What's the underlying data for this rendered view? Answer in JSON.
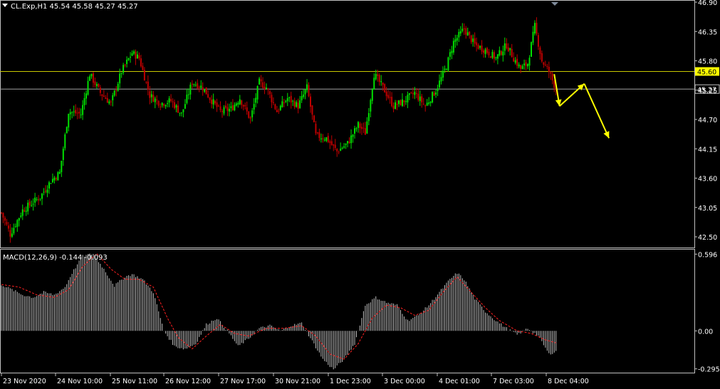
{
  "header": {
    "symbol_info": "CL.Exp,H1  45.54 45.58 45.27 45.27"
  },
  "indicator": {
    "label": "MACD(12,26,9) -0.144 -0.093"
  },
  "colors": {
    "background": "#000000",
    "frame": "#c0c0c0",
    "bull_candle": "#00e000",
    "bear_candle": "#c00000",
    "price_line": "#c8c800",
    "price_tag_bg": "#ffff00",
    "bid_line": "#a0a0a0",
    "arrow": "#ffff00",
    "histogram": "#c0c0c0",
    "signal": "#ff2020",
    "text": "#ffffff"
  },
  "chart_data": [
    {
      "type": "candlestick",
      "symbol": "CL.Exp",
      "timeframe": "H1",
      "ohlc_last": {
        "open": 45.54,
        "high": 45.58,
        "low": 45.27,
        "close": 45.27
      },
      "ylim": [
        42.3,
        46.9
      ],
      "y_ticks": [
        "46.90",
        "46.35",
        "45.80",
        "45.25",
        "44.70",
        "44.15",
        "43.60",
        "43.05",
        "42.50"
      ],
      "x_ticks": [
        "23 Nov 2020",
        "24 Nov 10:00",
        "25 Nov 11:00",
        "26 Nov 12:00",
        "27 Nov 17:00",
        "30 Nov 21:00",
        "1 Dec 23:00",
        "3 Dec 00:00",
        "4 Dec 01:00",
        "7 Dec 03:00",
        "8 Dec 04:00"
      ],
      "horizontal_lines": [
        {
          "value": 45.6,
          "label": "45.60",
          "kind": "level"
        },
        {
          "value": 45.27,
          "label": "45.27",
          "kind": "bid"
        }
      ],
      "anchors": [
        [
          0,
          42.95
        ],
        [
          5,
          42.55
        ],
        [
          12,
          43.0
        ],
        [
          22,
          43.25
        ],
        [
          28,
          43.55
        ],
        [
          33,
          43.7
        ],
        [
          38,
          44.85
        ],
        [
          45,
          44.8
        ],
        [
          50,
          45.55
        ],
        [
          56,
          45.2
        ],
        [
          62,
          45.0
        ],
        [
          68,
          45.6
        ],
        [
          74,
          45.95
        ],
        [
          78,
          45.85
        ],
        [
          84,
          45.15
        ],
        [
          90,
          45.0
        ],
        [
          96,
          45.05
        ],
        [
          102,
          44.8
        ],
        [
          108,
          45.4
        ],
        [
          114,
          45.3
        ],
        [
          118,
          45.1
        ],
        [
          124,
          44.85
        ],
        [
          130,
          44.9
        ],
        [
          135,
          45.1
        ],
        [
          141,
          44.7
        ],
        [
          146,
          45.4
        ],
        [
          150,
          45.3
        ],
        [
          156,
          44.85
        ],
        [
          162,
          45.1
        ],
        [
          168,
          44.95
        ],
        [
          173,
          45.3
        ],
        [
          178,
          44.4
        ],
        [
          184,
          44.35
        ],
        [
          190,
          44.1
        ],
        [
          196,
          44.25
        ],
        [
          202,
          44.6
        ],
        [
          206,
          44.45
        ],
        [
          211,
          45.55
        ],
        [
          216,
          45.3
        ],
        [
          222,
          44.95
        ],
        [
          228,
          45.05
        ],
        [
          234,
          45.2
        ],
        [
          240,
          44.95
        ],
        [
          246,
          45.25
        ],
        [
          252,
          45.7
        ],
        [
          256,
          46.15
        ],
        [
          262,
          46.4
        ],
        [
          268,
          46.1
        ],
        [
          274,
          46.0
        ],
        [
          280,
          45.85
        ],
        [
          286,
          46.1
        ],
        [
          290,
          45.85
        ],
        [
          294,
          45.65
        ],
        [
          298,
          45.75
        ],
        [
          302,
          46.45
        ],
        [
          306,
          45.8
        ],
        [
          310,
          45.6
        ],
        [
          314,
          45.27
        ]
      ],
      "anchors_note": "close price at hourly bar index",
      "bar_count": 315,
      "annotations": [
        {
          "type": "arrow",
          "from": [
            313,
            45.55
          ],
          "to": [
            316,
            44.95
          ]
        },
        {
          "type": "arrow",
          "from": [
            316,
            44.95
          ],
          "to": [
            330,
            45.37
          ]
        },
        {
          "type": "arrow",
          "from": [
            330,
            45.37
          ],
          "to": [
            344,
            44.35
          ]
        }
      ]
    },
    {
      "type": "macd",
      "params": "MACD(12,26,9)",
      "macd_last": -0.144,
      "signal_last": -0.093,
      "ylim": [
        -0.33,
        0.62
      ],
      "y_ticks": [
        "0.596",
        "0.00",
        "-0.295"
      ],
      "histogram_anchors": [
        [
          0,
          0.36
        ],
        [
          6,
          0.32
        ],
        [
          12,
          0.28
        ],
        [
          18,
          0.26
        ],
        [
          24,
          0.3
        ],
        [
          30,
          0.28
        ],
        [
          36,
          0.34
        ],
        [
          40,
          0.45
        ],
        [
          46,
          0.58
        ],
        [
          52,
          0.6
        ],
        [
          58,
          0.48
        ],
        [
          64,
          0.35
        ],
        [
          70,
          0.42
        ],
        [
          74,
          0.44
        ],
        [
          80,
          0.4
        ],
        [
          86,
          0.3
        ],
        [
          92,
          0.0
        ],
        [
          98,
          -0.12
        ],
        [
          104,
          -0.14
        ],
        [
          110,
          -0.1
        ],
        [
          116,
          0.05
        ],
        [
          122,
          0.1
        ],
        [
          128,
          0.0
        ],
        [
          134,
          -0.12
        ],
        [
          140,
          -0.06
        ],
        [
          146,
          0.02
        ],
        [
          152,
          0.04
        ],
        [
          158,
          0.0
        ],
        [
          164,
          0.04
        ],
        [
          170,
          0.06
        ],
        [
          176,
          -0.08
        ],
        [
          182,
          -0.22
        ],
        [
          188,
          -0.3
        ],
        [
          194,
          -0.22
        ],
        [
          200,
          -0.1
        ],
        [
          206,
          0.2
        ],
        [
          212,
          0.26
        ],
        [
          218,
          0.22
        ],
        [
          224,
          0.2
        ],
        [
          230,
          0.08
        ],
        [
          236,
          0.12
        ],
        [
          242,
          0.2
        ],
        [
          248,
          0.3
        ],
        [
          254,
          0.4
        ],
        [
          258,
          0.45
        ],
        [
          262,
          0.4
        ],
        [
          268,
          0.25
        ],
        [
          274,
          0.15
        ],
        [
          280,
          0.08
        ],
        [
          286,
          0.02
        ],
        [
          292,
          -0.03
        ],
        [
          298,
          0.02
        ],
        [
          304,
          -0.04
        ],
        [
          310,
          -0.18
        ],
        [
          314,
          -0.16
        ]
      ],
      "signal_anchors": [
        [
          0,
          0.36
        ],
        [
          10,
          0.34
        ],
        [
          20,
          0.28
        ],
        [
          30,
          0.26
        ],
        [
          38,
          0.32
        ],
        [
          46,
          0.5
        ],
        [
          54,
          0.6
        ],
        [
          62,
          0.48
        ],
        [
          70,
          0.4
        ],
        [
          78,
          0.4
        ],
        [
          86,
          0.34
        ],
        [
          94,
          0.1
        ],
        [
          100,
          -0.05
        ],
        [
          108,
          -0.14
        ],
        [
          116,
          -0.04
        ],
        [
          124,
          0.05
        ],
        [
          132,
          -0.02
        ],
        [
          140,
          -0.04
        ],
        [
          150,
          0.02
        ],
        [
          160,
          0.02
        ],
        [
          170,
          0.04
        ],
        [
          178,
          -0.04
        ],
        [
          186,
          -0.18
        ],
        [
          194,
          -0.22
        ],
        [
          202,
          -0.1
        ],
        [
          210,
          0.1
        ],
        [
          218,
          0.2
        ],
        [
          226,
          0.18
        ],
        [
          234,
          0.12
        ],
        [
          242,
          0.16
        ],
        [
          250,
          0.3
        ],
        [
          258,
          0.42
        ],
        [
          266,
          0.3
        ],
        [
          274,
          0.18
        ],
        [
          282,
          0.08
        ],
        [
          292,
          0.0
        ],
        [
          300,
          -0.02
        ],
        [
          308,
          -0.07
        ],
        [
          314,
          -0.093
        ]
      ]
    }
  ]
}
